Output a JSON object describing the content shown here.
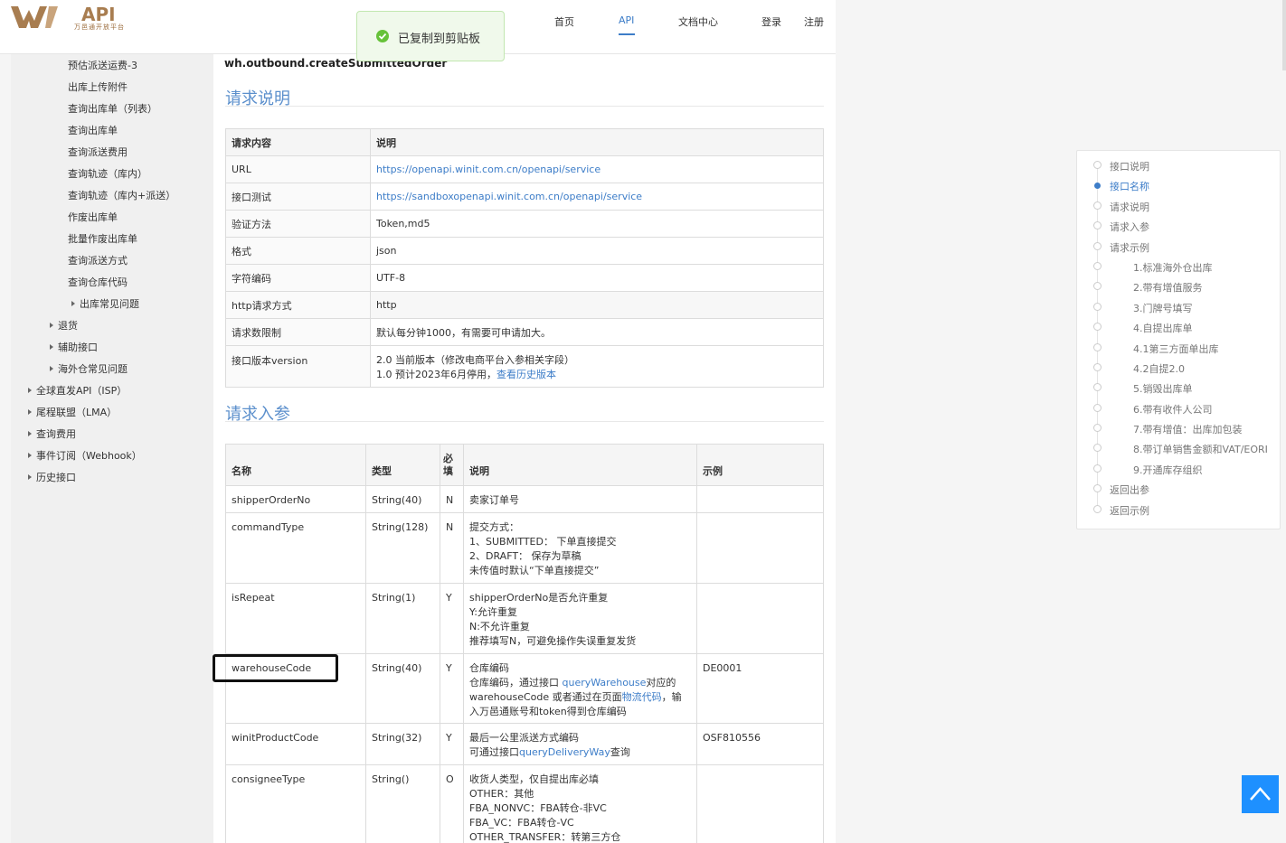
{
  "header": {
    "logo_text": "API",
    "logo_sub": "万邑通开放平台",
    "nav": [
      "首页",
      "API",
      "文档中心",
      "登录",
      "注册"
    ]
  },
  "toast": {
    "message": "已复制到剪贴板",
    "color": "#67c23a"
  },
  "sidebar": {
    "items": [
      "预估派送运费-3",
      "出库上传附件",
      "查询出库单（列表）",
      "查询出库单",
      "查询派送费用",
      "查询轨迹（库内）",
      "查询轨迹（库内+派送）",
      "作废出库单",
      "批量作废出库单",
      "查询派送方式",
      "查询仓库代码"
    ],
    "collapsed": [
      "出库常见问题",
      "退货",
      "辅助接口",
      "海外仓常见问题",
      "全球直发API（ISP）",
      "尾程联盟（LMA）",
      "查询费用",
      "事件订阅（Webhook）",
      "历史接口"
    ]
  },
  "main": {
    "method": "wh.outbound.createSubmittedOrder",
    "section1": "请求说明",
    "section2": "请求入参",
    "req_table": {
      "headers": [
        "请求内容",
        "说明"
      ],
      "rows": [
        [
          "URL",
          "https://openapi.winit.com.cn/openapi/service"
        ],
        [
          "接口测试",
          "https://sandboxopenapi.winit.com.cn/openapi/service"
        ],
        [
          "验证方法",
          "Token,md5"
        ],
        [
          "格式",
          "json"
        ],
        [
          "字符编码",
          "UTF-8"
        ],
        [
          "http请求方式",
          "http"
        ],
        [
          "请求数限制",
          "默认每分钟1000，有需要可申请加大。"
        ],
        [
          "接口版本version",
          "2.0 当前版本（修改电商平台入参相关字段）"
        ]
      ],
      "version_line2": "1.0 预计2023年6月停用，",
      "version_link": "查看历史版本"
    },
    "param_table": {
      "headers": [
        "名称",
        "类型",
        "必填",
        "说明",
        "示例"
      ],
      "rows": [
        {
          "name": "shipperOrderNo",
          "type": "String(40)",
          "req": "N",
          "desc": [
            "卖家订单号"
          ],
          "example": ""
        },
        {
          "name": "commandType",
          "type": "String(128)",
          "req": "N",
          "desc": [
            "提交方式：",
            "1、SUBMITTED： 下单直接提交",
            "2、DRAFT： 保存为草稿",
            "未传值时默认“下单直接提交”"
          ],
          "example": ""
        },
        {
          "name": "isRepeat",
          "type": "String(1)",
          "req": "Y",
          "desc": [
            "shipperOrderNo是否允许重复",
            "Y:允许重复",
            "N:不允许重复",
            "推荐填写N，可避免操作失误重复发货"
          ],
          "example": ""
        },
        {
          "name": "warehouseCode",
          "type": "String(40)",
          "req": "Y",
          "desc": [
            "仓库编码"
          ],
          "example": "DE0001"
        },
        {
          "name": "winitProductCode",
          "type": "String(32)",
          "req": "Y",
          "desc": [
            "最后一公里派送方式编码"
          ],
          "example": "OSF810556"
        },
        {
          "name": "consigneeType",
          "type": "String()",
          "req": "O",
          "desc": [
            "收货人类型，仅自提出库必填",
            "OTHER：其他",
            "FBA_NONVC：FBA转仓-非VC",
            "FBA_VC：FBA转仓-VC",
            "OTHER_TRANSFER：转第三方仓"
          ],
          "example": ""
        }
      ],
      "wh_desc": {
        "pre": "仓库编码，通过接口 ",
        "link1": "queryWarehouse",
        "mid": "对应的warehouseCode 或者通过在页面",
        "link2": "物流代码",
        "post": "，输入万邑通账号和token得到仓库编码"
      },
      "prod_desc": {
        "pre": "可通过接口",
        "link": "queryDeliveryWay",
        "post": "查询"
      }
    }
  },
  "toc": {
    "items": [
      "接口说明",
      "接口名称",
      "请求说明",
      "请求入参",
      "请求示例",
      "1.标准海外仓出库",
      "2.带有增值服务",
      "3.门牌号填写",
      "4.自提出库单",
      "4.1第三方面单出库",
      "4.2自提2.0",
      "5.销毁出库单",
      "6.带有收件人公司",
      "7.带有增值：出库加包装",
      "8.带订单销售金额和VAT/EORI",
      "9.开通库存组织",
      "返回出参",
      "返回示例"
    ],
    "active_index": 1
  }
}
